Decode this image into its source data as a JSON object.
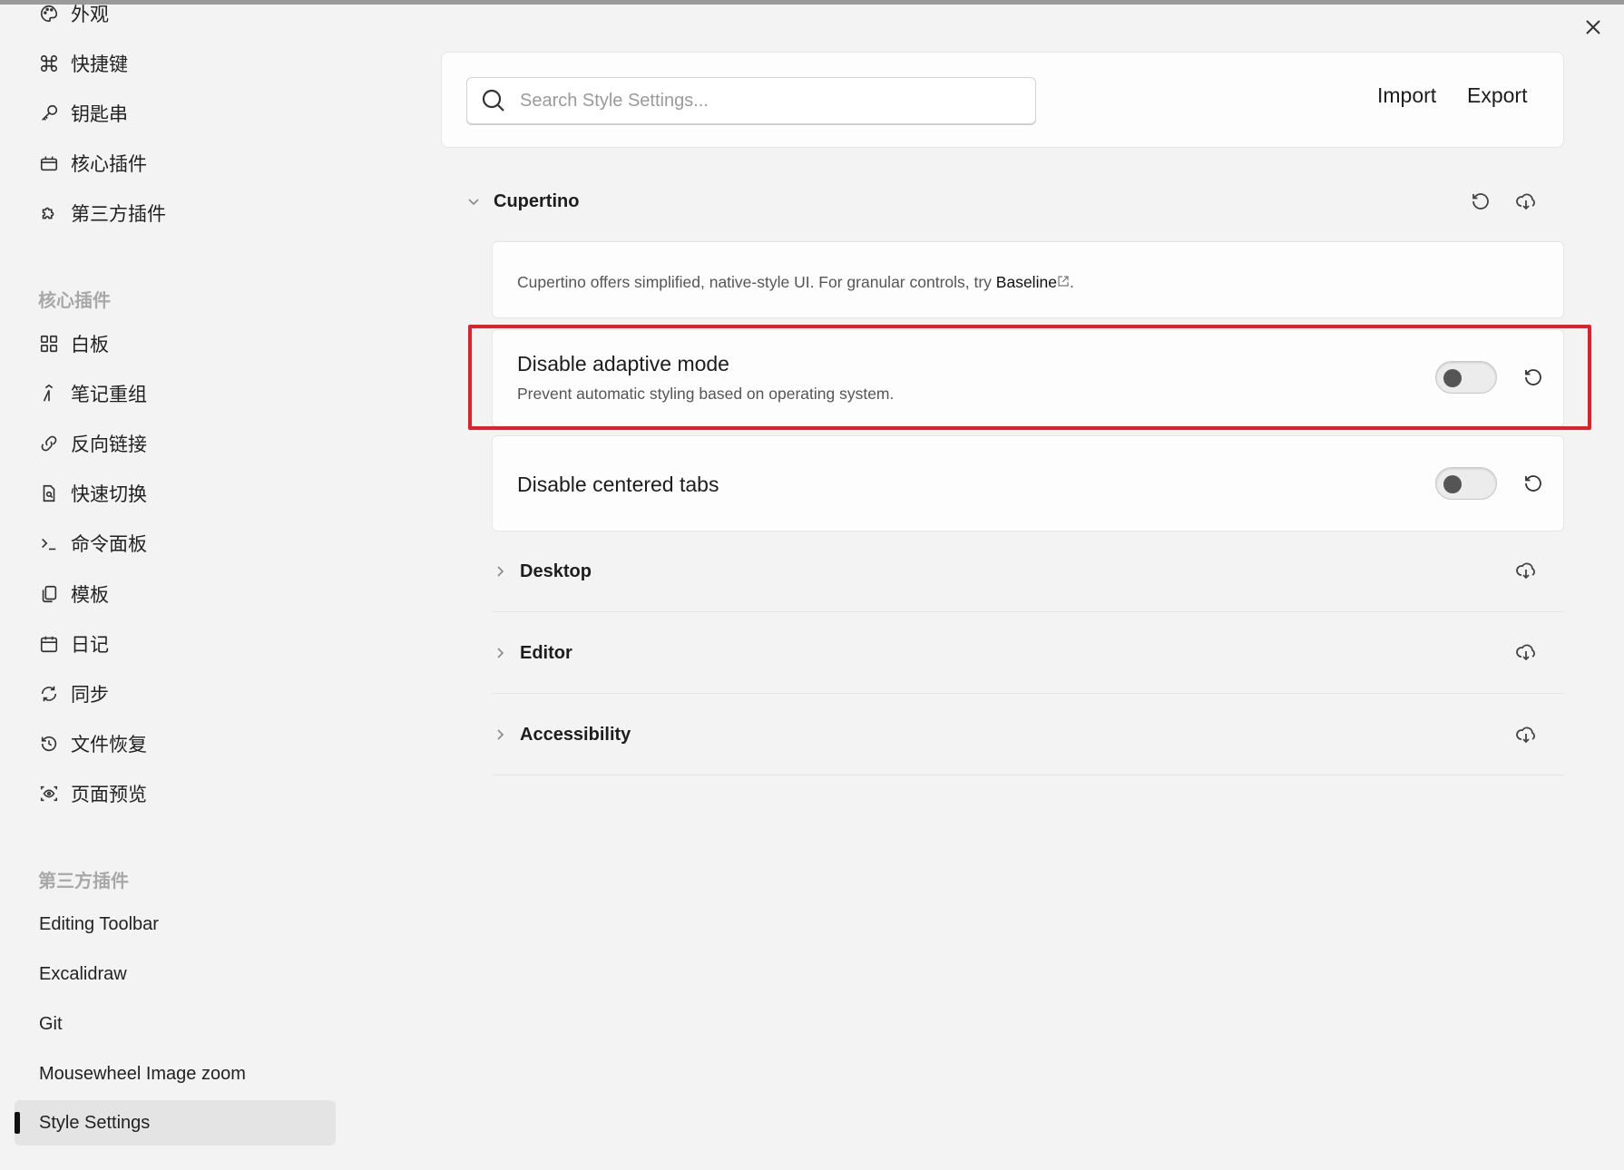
{
  "sidebar": {
    "top_items": [
      {
        "label": "外观",
        "icon": "palette-icon"
      },
      {
        "label": "快捷键",
        "icon": "command-icon"
      },
      {
        "label": "钥匙串",
        "icon": "key-icon"
      },
      {
        "label": "核心插件",
        "icon": "plug-icon"
      },
      {
        "label": "第三方插件",
        "icon": "puzzle-icon"
      }
    ],
    "core_header": "核心插件",
    "core_items": [
      {
        "label": "白板",
        "icon": "grid-icon"
      },
      {
        "label": "笔记重组",
        "icon": "merge-icon"
      },
      {
        "label": "反向链接",
        "icon": "backlink-icon"
      },
      {
        "label": "快速切换",
        "icon": "file-search-icon"
      },
      {
        "label": "命令面板",
        "icon": "terminal-icon"
      },
      {
        "label": "模板",
        "icon": "copy-icon"
      },
      {
        "label": "日记",
        "icon": "calendar-icon"
      },
      {
        "label": "同步",
        "icon": "sync-icon"
      },
      {
        "label": "文件恢复",
        "icon": "history-icon"
      },
      {
        "label": "页面预览",
        "icon": "preview-icon"
      }
    ],
    "third_header": "第三方插件",
    "third_items": [
      {
        "label": "Editing Toolbar"
      },
      {
        "label": "Excalidraw"
      },
      {
        "label": "Git"
      },
      {
        "label": "Mousewheel Image zoom"
      },
      {
        "label": "Style Settings",
        "active": true
      }
    ]
  },
  "search": {
    "placeholder": "Search Style Settings..."
  },
  "actions": {
    "import_label": "Import",
    "export_label": "Export"
  },
  "cupertino": {
    "title": "Cupertino",
    "description": "Cupertino offers simplified, native-style UI. For granular controls, try ",
    "description_link": "Baseline",
    "description_end": ".",
    "settings": [
      {
        "title": "Disable adaptive mode",
        "subtitle": "Prevent automatic styling based on operating system.",
        "enabled": false
      },
      {
        "title": "Disable centered tabs",
        "enabled": false
      }
    ]
  },
  "groups": [
    {
      "title": "Desktop"
    },
    {
      "title": "Editor"
    },
    {
      "title": "Accessibility"
    }
  ],
  "colors": {
    "highlight": "#e0202a",
    "accent_active": "#111111"
  }
}
